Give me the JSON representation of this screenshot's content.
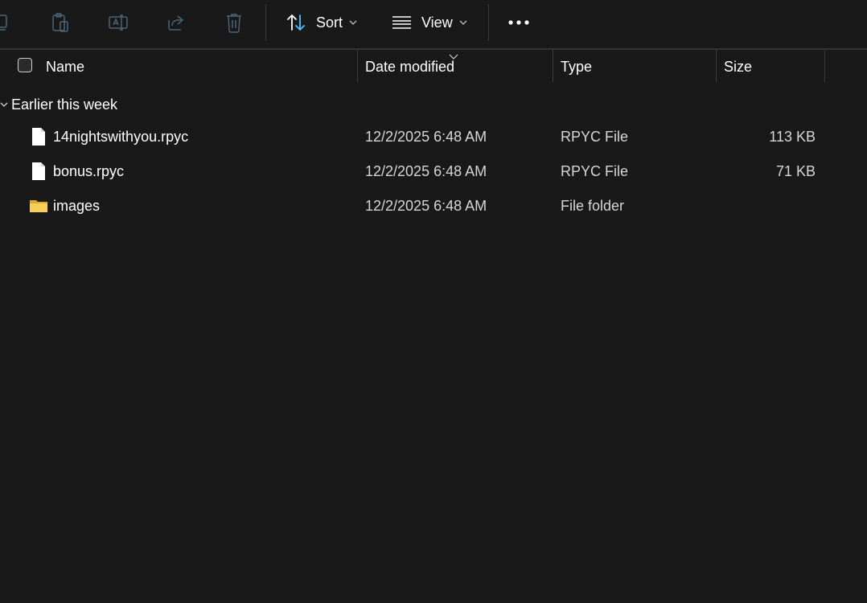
{
  "toolbar": {
    "icons": [
      "copy-icon",
      "paste-icon",
      "rename-icon",
      "share-icon",
      "delete-icon"
    ],
    "sort_label": "Sort",
    "view_label": "View",
    "more_icon": "more-horizontal-icon"
  },
  "columns": {
    "name": "Name",
    "date_modified": "Date modified",
    "type": "Type",
    "size": "Size"
  },
  "group": {
    "label": "Earlier this week"
  },
  "files": [
    {
      "name": "14nightswithyou.rpyc",
      "date": "12/2/2025 6:48 AM",
      "type": "RPYC File",
      "size": "113 KB",
      "icon": "file-icon"
    },
    {
      "name": "bonus.rpyc",
      "date": "12/2/2025 6:48 AM",
      "type": "RPYC File",
      "size": "71 KB",
      "icon": "file-icon"
    },
    {
      "name": "images",
      "date": "12/2/2025 6:48 AM",
      "type": "File folder",
      "size": "",
      "icon": "folder-icon"
    }
  ],
  "colors": {
    "background": "#191919",
    "icon_muted": "#4a6577",
    "accent": "#4cc2ff",
    "folder": "#f0c14b"
  }
}
